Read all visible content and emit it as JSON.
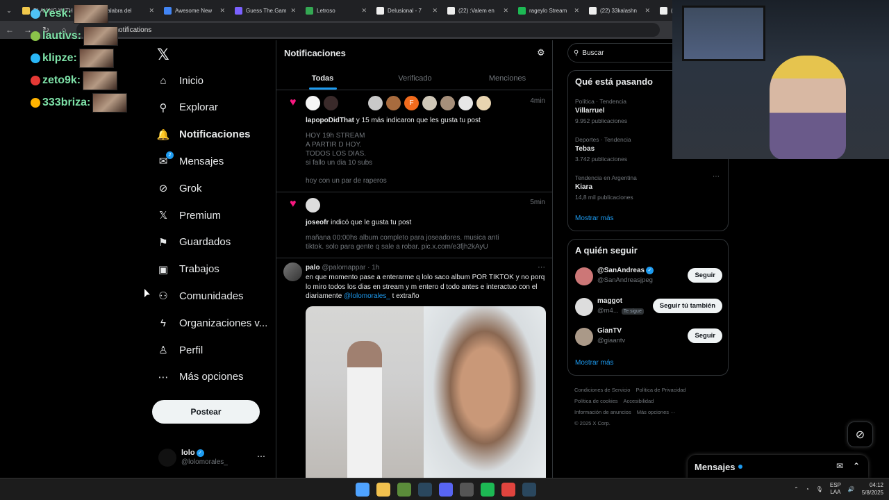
{
  "browser": {
    "tabs": [
      {
        "title": "PLAYING WITH",
        "color": "#f2c94c"
      },
      {
        "title": "palabra del",
        "color": "#5f6368"
      },
      {
        "title": "Awesome New",
        "color": "#4285f4"
      },
      {
        "title": "Guess The.Gam",
        "color": "#7b61ff"
      },
      {
        "title": "Letroso",
        "color": "#34a853"
      },
      {
        "title": "Delusional - 7",
        "color": "#eeeeee"
      },
      {
        "title": "(22) :Valem en",
        "color": "#eeeeee"
      },
      {
        "title": "rageylo Stream",
        "color": "#1db954"
      },
      {
        "title": "(22) 33kalashn",
        "color": "#eeeeee"
      },
      {
        "title": "(22)",
        "color": "#eeeeee"
      }
    ],
    "url": "x.com/notifications"
  },
  "overlay": {
    "users": [
      {
        "name": "Yesk:",
        "badge": "#4fc3f7"
      },
      {
        "name": "lautivs:",
        "badge": "#8bc34a"
      },
      {
        "name": "klipze:",
        "badge": "#29b6f6"
      },
      {
        "name": "zeto9k:",
        "badge": "#e53935"
      },
      {
        "name": "333briza:",
        "badge": "#ffb300"
      }
    ]
  },
  "nav": {
    "logo": "𝕏",
    "items": [
      {
        "label": "Inicio",
        "icon": "⌂"
      },
      {
        "label": "Explorar",
        "icon": "⚲"
      },
      {
        "label": "Notificaciones",
        "icon": "🔔"
      },
      {
        "label": "Mensajes",
        "icon": "✉"
      },
      {
        "label": "Grok",
        "icon": "⊘"
      },
      {
        "label": "Premium",
        "icon": "𝕏"
      },
      {
        "label": "Guardados",
        "icon": "⚑"
      },
      {
        "label": "Trabajos",
        "icon": "▣"
      },
      {
        "label": "Comunidades",
        "icon": "⚇"
      },
      {
        "label": "Organizaciones v...",
        "icon": "ϟ"
      },
      {
        "label": "Perfil",
        "icon": "♙"
      },
      {
        "label": "Más opciones",
        "icon": "⋯"
      }
    ],
    "messages_badge": "2",
    "post_button": "Postear",
    "account": {
      "name": "lolo",
      "handle": "@lolomorales_",
      "more": "⋯"
    }
  },
  "main": {
    "title": "Notificaciones",
    "tabs": [
      "Todas",
      "Verificado",
      "Menciones"
    ],
    "notif1": {
      "time": "4min",
      "user": "lapopoDidThat",
      "action": " y 15 más indicaron que les gusta tu post",
      "lines": [
        "HOY 19h STREAM",
        "A PARTIR D HOY.",
        "TODOS LOS DIAS.",
        "si fallo un dia 10 subs",
        "",
        "hoy con un par de raperos"
      ],
      "avatar_colors": [
        "#f5f5f5",
        "#3a2a2a",
        "#c9c9c9",
        "#a86b3e",
        "#f26b1d",
        "#d0c8b8",
        "#a68f7a",
        "#e6e6e6",
        "#e8d4b0"
      ],
      "avatar_letter": "F"
    },
    "notif2": {
      "time": "5min",
      "user": "joseofr",
      "action": " indicó que le gusta tu post",
      "lines": [
        "mañana 00:00hs album completo para joseadores. musica anti",
        "tiktok. solo para gente q sale a robar. pic.x.com/e3fjh2kAyU"
      ]
    },
    "post": {
      "name": "palo",
      "handle": "@palomappar",
      "time": "· 1h",
      "text_before": "en que momento pase a enterarme q lolo saco album POR TIKTOK y no porq lo miro todos los dias en stream y m entero d todo antes e interactuo con el diariamente ",
      "mention": "@lolomorales_",
      "text_after": " t extraño"
    }
  },
  "right": {
    "search_placeholder": "Buscar",
    "trends_title": "Qué está pasando",
    "trends": [
      {
        "context": "Política · Tendencia",
        "name": "Villarruel",
        "posts": "9.952 publicaciones"
      },
      {
        "context": "Deportes · Tendencia",
        "name": "Tebas",
        "posts": "3.742 publicaciones"
      },
      {
        "context": "Tendencia en Argentina",
        "name": "Kiara",
        "posts": "14,8 mil publicaciones"
      }
    ],
    "show_more": "Mostrar más",
    "follow_title": "A quién seguir",
    "follow": [
      {
        "name": "@SanAndreas",
        "handle": "@SanAndreasjpeg",
        "button": "Seguir",
        "color": "#c77"
      },
      {
        "name": "maggot",
        "handle": "@m4...",
        "tag": "Te sigue",
        "button": "Seguir tú también",
        "color": "#ddd"
      },
      {
        "name": "GianTV",
        "handle": "@giaantv",
        "button": "Seguir",
        "color": "#a98"
      }
    ],
    "footer": [
      "Condiciones de Servicio",
      "Política de Privacidad",
      "Política de cookies",
      "Accesibilidad",
      "Información de anuncios",
      "Más opciones ···",
      "© 2025 X Corp."
    ]
  },
  "messages_widget": {
    "label": "Mensajes"
  },
  "taskbar": {
    "lang": "ESP",
    "lang2": "LAA",
    "time": "04:12",
    "date": "5/8/2025",
    "icons": [
      "#4fa3ff",
      "#f2c14e",
      "#5b8c3a",
      "#2a475e",
      "#5865f2",
      "#555555",
      "#1db954",
      "#e0443e",
      "#2a475e"
    ]
  }
}
